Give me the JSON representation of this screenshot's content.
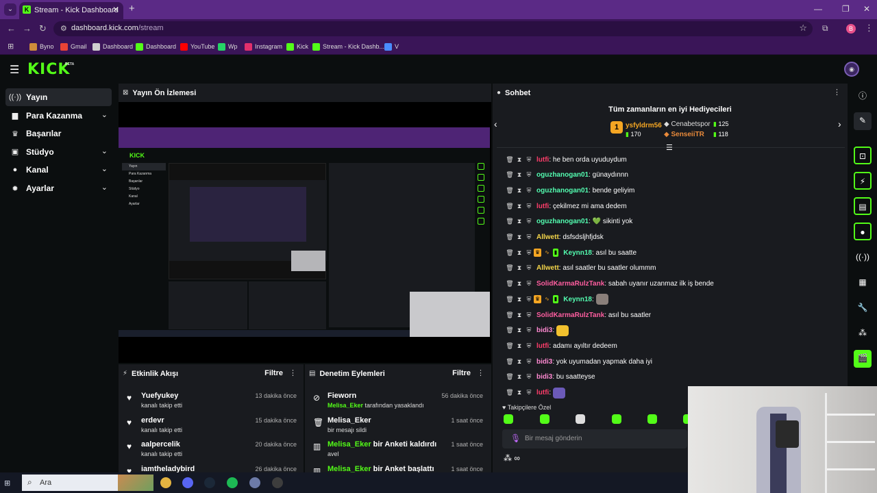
{
  "browser": {
    "tab_title": "Stream - Kick Dashboard",
    "url_host": "dashboard.kick.com",
    "url_path": "/stream",
    "profile_initial": "B",
    "bookmarks": [
      {
        "label": "Byno",
        "color": "#d08c3a"
      },
      {
        "label": "Gmail",
        "color": "#ea4335"
      },
      {
        "label": "Dashboard",
        "color": "#cfcfcf"
      },
      {
        "label": "Dashboard",
        "color": "#53fc18"
      },
      {
        "label": "YouTube",
        "color": "#ff0000"
      },
      {
        "label": "Wp",
        "color": "#25d366"
      },
      {
        "label": "Instagram",
        "color": "#e1306c"
      },
      {
        "label": "Kick",
        "color": "#53fc18"
      },
      {
        "label": "Stream - Kick Dashb...",
        "color": "#53fc18"
      },
      {
        "label": "V",
        "color": "#4a8cff"
      }
    ]
  },
  "app": {
    "logo": "KICK",
    "beta": "BETA",
    "accent": "#53fc18"
  },
  "sidebar": {
    "items": [
      {
        "label": "Yayın",
        "icon": "broadcast-icon",
        "glyph": "((·))",
        "active": true,
        "chevron": false
      },
      {
        "label": "Para Kazanma",
        "icon": "wallet-icon",
        "glyph": "▆",
        "active": false,
        "chevron": true
      },
      {
        "label": "Başarılar",
        "icon": "trophy-icon",
        "glyph": "♛",
        "active": false,
        "chevron": false
      },
      {
        "label": "Stüdyo",
        "icon": "studio-icon",
        "glyph": "▣",
        "active": false,
        "chevron": true
      },
      {
        "label": "Kanal",
        "icon": "user-icon",
        "glyph": "●",
        "active": false,
        "chevron": true
      },
      {
        "label": "Ayarlar",
        "icon": "gear-icon",
        "glyph": "✹",
        "active": false,
        "chevron": true
      }
    ]
  },
  "preview": {
    "title": "Yayın Ön İzlemesi"
  },
  "activity": {
    "title": "Etkinlik Akışı",
    "filter": "Filtre",
    "rows": [
      {
        "name": "Yuefyukey",
        "sub": "kanalı takip etti",
        "time": "13 dakika önce"
      },
      {
        "name": "erdevr",
        "sub": "kanalı takip etti",
        "time": "15 dakika önce"
      },
      {
        "name": "aalpercelik",
        "sub": "kanalı takip etti",
        "time": "20 dakika önce"
      },
      {
        "name": "iamtheladybird",
        "sub": "",
        "time": "26 dakika önce"
      }
    ]
  },
  "moderation": {
    "title": "Denetim Eylemleri",
    "filter": "Filtre",
    "rows": [
      {
        "icon": "ban-icon",
        "glyph": "⊘",
        "name": "Fieworn",
        "action": "",
        "sub_user": "Melisa_Eker",
        "sub": " tarafından yasaklandı",
        "time": "56 dakika önce"
      },
      {
        "icon": "trash-icon",
        "glyph": "🗑",
        "name": "Melisa_Eker",
        "action": "",
        "sub_user": "",
        "sub": "bir mesajı sildi",
        "time": "1 saat önce"
      },
      {
        "icon": "poll-icon",
        "glyph": "▥",
        "name": "Melisa_Eker",
        "action": " bir Anketi kaldırdı",
        "sub_user": "",
        "sub": "avel",
        "time": "1 saat önce"
      },
      {
        "icon": "poll-icon",
        "glyph": "▥",
        "name": "Melisa_Eker",
        "action": " bir Anket başlattı",
        "sub_user": "",
        "sub": "",
        "time": "1 saat önce"
      }
    ]
  },
  "chat": {
    "title": "Sohbet",
    "leaderboard_title": "Tüm zamanların en iyi Hediyecileri",
    "top_rank": "1",
    "top_name": "ysfyldrm56",
    "top_count": "170",
    "second_name": "Cenabetspor",
    "second_count": "125",
    "third_name": "SenseiiTR",
    "third_count": "118",
    "messages": [
      {
        "user": "lutfi",
        "color": "#ff3d6a",
        "text": ": he ben orda uyuduydum",
        "extra": "",
        "emote": ""
      },
      {
        "user": "oguzhanogan01",
        "color": "#53fcb0",
        "text": ": günaydınnn",
        "extra": "",
        "emote": ""
      },
      {
        "user": "oguzhanogan01",
        "color": "#53fcb0",
        "text": ": bende geliyim",
        "extra": "",
        "emote": ""
      },
      {
        "user": "lutfi",
        "color": "#ff3d6a",
        "text": ": çekilmez mi ama dedem",
        "extra": "",
        "emote": ""
      },
      {
        "user": "oguzhanogan01",
        "color": "#53fcb0",
        "text": ": 💚 sikinti yok",
        "extra": "",
        "emote": ""
      },
      {
        "user": "Allwett",
        "color": "#f5d64a",
        "text": ": dsfsdsljhfjdsk",
        "extra": "",
        "emote": ""
      },
      {
        "user": "Keynn18",
        "color": "#53fcb0",
        "text": ": asıl bu saatte",
        "extra": "badges",
        "emote": ""
      },
      {
        "user": "Allwett",
        "color": "#f5d64a",
        "text": ": asıl saatler bu saatler olummm",
        "extra": "",
        "emote": ""
      },
      {
        "user": "SolidKarmaRulzTank",
        "color": "#ff5ea0",
        "text": ": sabah uyanır uzanmaz ilk iş bende",
        "extra": "",
        "emote": ""
      },
      {
        "user": "Keynn18",
        "color": "#53fcb0",
        "text": ":",
        "extra": "badges",
        "emote": "#8a7f7a"
      },
      {
        "user": "SolidKarmaRulzTank",
        "color": "#ff5ea0",
        "text": ": asıl bu saatler",
        "extra": "",
        "emote": ""
      },
      {
        "user": "bidi3",
        "color": "#ff8ad1",
        "text": ":",
        "extra": "",
        "emote": "#f2c12e"
      },
      {
        "user": "lutfi",
        "color": "#ff3d6a",
        "text": ": adamı ayıltır dedeem",
        "extra": "",
        "emote": ""
      },
      {
        "user": "bidi3",
        "color": "#ff8ad1",
        "text": ": yok uyumadan yapmak daha iyi",
        "extra": "",
        "emote": ""
      },
      {
        "user": "bidi3",
        "color": "#ff8ad1",
        "text": ": bu saatteyse",
        "extra": "",
        "emote": ""
      },
      {
        "user": "lutfi",
        "color": "#ff3d6a",
        "text": ":",
        "extra": "",
        "emote": "#6b5ab8"
      }
    ],
    "followers_only": "Takipçilere Özel",
    "input_placeholder": "Bir mesaj gönderin"
  },
  "taskbar": {
    "search_placeholder": "Ara"
  }
}
